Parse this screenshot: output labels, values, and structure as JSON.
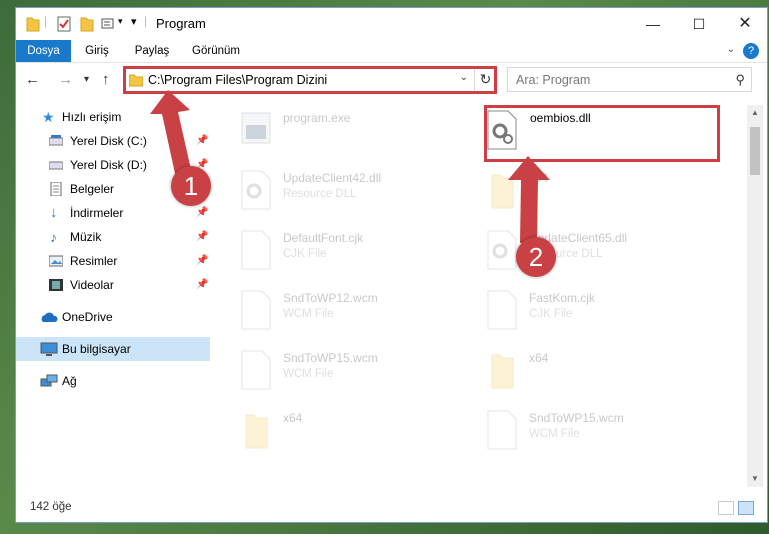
{
  "window": {
    "title": "Program"
  },
  "ribbon": {
    "tabs": [
      "Dosya",
      "Giriş",
      "Paylaş",
      "Görünüm"
    ],
    "help": "?"
  },
  "address": {
    "path": "C:\\Program Files\\Program Dizini"
  },
  "search": {
    "placeholder": "Ara: Program"
  },
  "sidebar": {
    "items": [
      {
        "label": "Hızlı erişim"
      },
      {
        "label": "Yerel Disk (C:)"
      },
      {
        "label": "Yerel Disk (D:)"
      },
      {
        "label": "Belgeler"
      },
      {
        "label": "İndirmeler"
      },
      {
        "label": "Müzik"
      },
      {
        "label": "Resimler"
      },
      {
        "label": "Videolar"
      },
      {
        "label": "OneDrive"
      },
      {
        "label": "Bu bilgisayar"
      },
      {
        "label": "Ağ"
      }
    ]
  },
  "files": [
    {
      "name": "program.exe",
      "type": ""
    },
    {
      "name": "oembios.dll",
      "type": ""
    },
    {
      "name": "UpdateClient42.dll",
      "type": "Resource DLL"
    },
    {
      "name": "x64",
      "type": ""
    },
    {
      "name": "DefaultFont.cjk",
      "type": "CJK File"
    },
    {
      "name": "UpdateClient65.dll",
      "type": "Resource DLL"
    },
    {
      "name": "SndToWP12.wcm",
      "type": "WCM File"
    },
    {
      "name": "FastKom.cjk",
      "type": "CJK File"
    },
    {
      "name": "SndToWP15.wcm",
      "type": "WCM File"
    },
    {
      "name": "x64",
      "type": ""
    },
    {
      "name": "x64",
      "type": ""
    },
    {
      "name": "SndToWP15.wcm",
      "type": "WCM File"
    }
  ],
  "status": {
    "count": "142 öğe"
  },
  "annotations": {
    "badge1": "1",
    "badge2": "2",
    "color": "#c94045"
  }
}
